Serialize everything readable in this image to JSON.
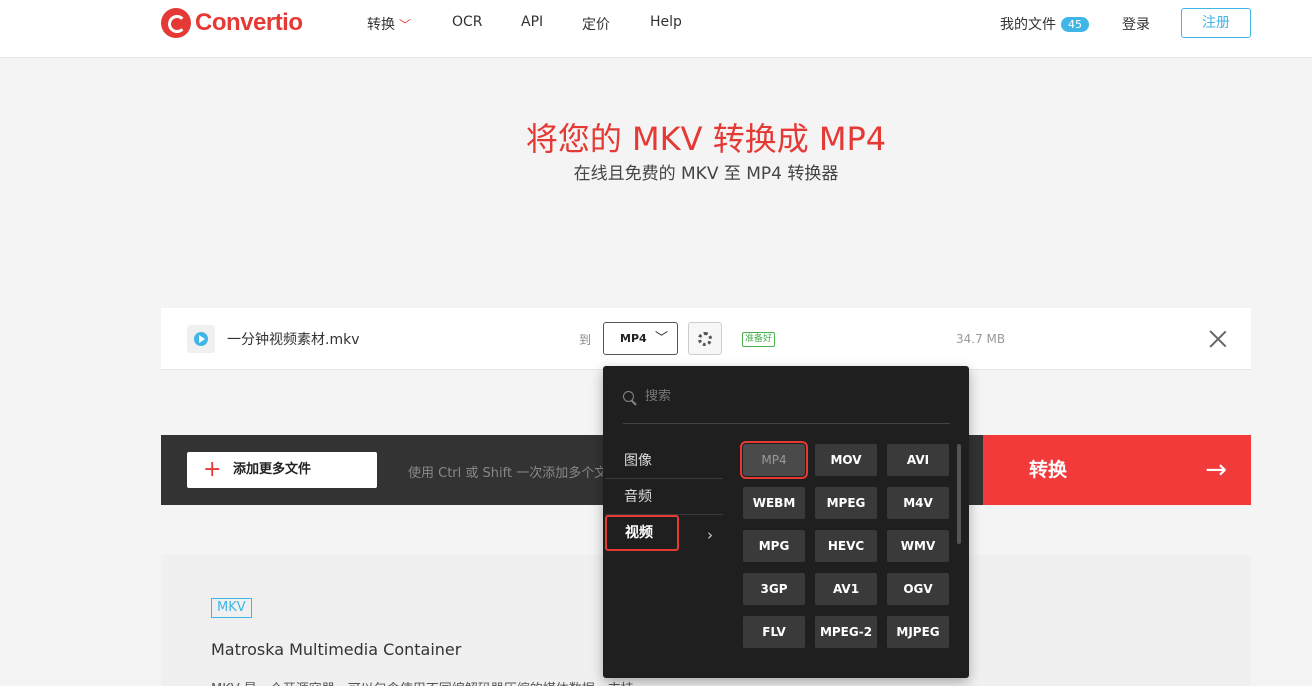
{
  "header": {
    "logo_text": "Convertio",
    "nav": {
      "convert": "转换",
      "ocr": "OCR",
      "api": "API",
      "pricing": "定价",
      "help": "Help"
    },
    "my_files": "我的文件",
    "my_files_count": "45",
    "login": "登录",
    "signup": "注册"
  },
  "hero": {
    "title": "将您的 MKV 转换成 MP4",
    "subtitle": "在线且免费的 MKV 至 MP4 转换器"
  },
  "file": {
    "name": "一分钟视频素材.mkv",
    "to_label": "到",
    "format": "MP4",
    "status": "准备好",
    "size": "34.7 MB"
  },
  "actions": {
    "add_files": "添加更多文件",
    "hint": "使用 Ctrl 或 Shift 一次添加多个文件",
    "convert": "转换"
  },
  "info": {
    "tag": "MKV",
    "title": "Matroska Multimedia Container",
    "desc": "MKV 是一个开源容器，可以包含使用不同编解码器压缩的媒体数据。支持"
  },
  "dropdown": {
    "search_placeholder": "搜索",
    "categories": [
      {
        "label": "图像"
      },
      {
        "label": "音频"
      },
      {
        "label": "视频"
      }
    ],
    "selected_category": "视频",
    "formats": [
      "MP4",
      "MOV",
      "AVI",
      "WEBM",
      "MPEG",
      "M4V",
      "MPG",
      "HEVC",
      "WMV",
      "3GP",
      "AV1",
      "OGV",
      "FLV",
      "MPEG-2",
      "MJPEG"
    ],
    "selected_format": "MP4"
  },
  "colors": {
    "brand_red": "#e53935",
    "accent_blue": "#3fb6e6",
    "convert_red": "#f23a3a",
    "ready_green": "#4caf50"
  }
}
